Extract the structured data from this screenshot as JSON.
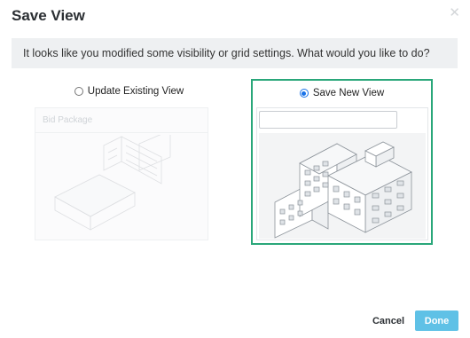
{
  "dialog": {
    "title": "Save View",
    "close_icon": "close-icon",
    "message": "It looks like you modified some visibility or grid settings. What would you like to do?"
  },
  "options": {
    "existing": {
      "label": "Update Existing View",
      "selected": false,
      "card_title": "Bid Package",
      "image_icon": "building-illustration"
    },
    "new": {
      "label": "Save New View",
      "selected": true,
      "name_value": "",
      "image_icon": "building-illustration"
    }
  },
  "footer": {
    "cancel_label": "Cancel",
    "done_label": "Done"
  },
  "colors": {
    "selected_border": "#2aa77a",
    "done_button": "#5fc1e6",
    "message_bg": "#eef0f2",
    "radio_accent": "#1a73e8"
  }
}
